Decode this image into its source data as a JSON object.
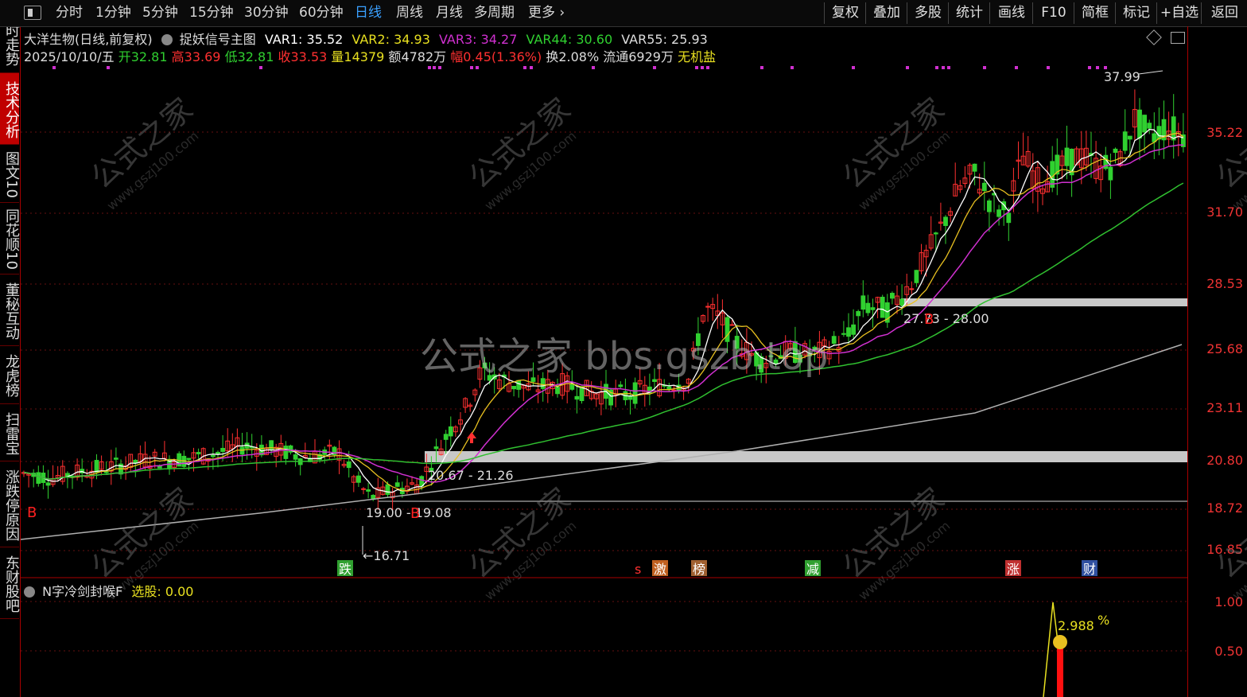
{
  "toolbar": {
    "left_items": [
      "分时",
      "1分钟",
      "5分钟",
      "15分钟",
      "30分钟",
      "60分钟",
      "日线",
      "周线",
      "月线",
      "多周期",
      "更多"
    ],
    "active": "日线",
    "right_items": [
      "复权",
      "叠加",
      "多股",
      "统计",
      "画线",
      "F10",
      "简框",
      "标记",
      "+自选",
      "返回"
    ]
  },
  "sidebar": [
    {
      "label": "分时走势",
      "active": false
    },
    {
      "label": "技术分析",
      "active": true
    },
    {
      "label": "图文10",
      "active": false
    },
    {
      "label": "同花顺10",
      "active": false
    },
    {
      "label": "董秘互动",
      "active": false
    },
    {
      "label": "龙虎榜",
      "active": false
    },
    {
      "label": "扫雷宝",
      "active": false
    },
    {
      "label": "涨跌停原因",
      "active": false
    },
    {
      "label": "东财股吧",
      "active": false
    }
  ],
  "header": {
    "stock": "大洋生物(日线,前复权)",
    "indicator": "捉妖信号主图",
    "var1": "VAR1: 35.52",
    "var2": "VAR2: 34.93",
    "var3": "VAR3: 34.27",
    "var44": "VAR44: 30.60",
    "var55": "VAR55: 25.93"
  },
  "quote": {
    "date": "2025/10/10/五",
    "open_label": "开",
    "open": "32.81",
    "high_label": "高",
    "high": "33.69",
    "low_label": "低",
    "low": "32.81",
    "close_label": "收",
    "close": "33.53",
    "vol_label": "量",
    "vol": "14379",
    "amt_label": "额",
    "amt": "4782万",
    "chg_label": "幅",
    "chg": "0.45(1.36%)",
    "turn": "换2.08%",
    "float": "流通6929万",
    "tag": "无机盐"
  },
  "axis_ticks": [
    "35.22",
    "31.70",
    "28.53",
    "25.68",
    "23.11",
    "20.80",
    "18.72",
    "16.85"
  ],
  "sub_axis_ticks": [
    "1.00",
    "0.50"
  ],
  "annotations": {
    "high": "37.99",
    "low": "16.71",
    "band1": "27.73 - 28.00",
    "band2": "20.67 - 21.26",
    "band3": "19.00 - 19.08"
  },
  "signals": [
    "跌",
    "s",
    "激",
    "榜",
    "减",
    "涨",
    "财"
  ],
  "buy_marker": "B",
  "subchart": {
    "title": "N字冷剑封喉F",
    "value": "选股: 0.00",
    "reading": "2.988",
    "unit": "%"
  },
  "watermark": {
    "brand": "公式之家",
    "url": "www.gszj100.com",
    "center": "公式之家 bbs.gszb.top"
  },
  "colors": {
    "up": "#ff3030",
    "down": "#30d030",
    "ma_white": "#ffffff",
    "ma_yellow": "#e8c020",
    "ma_magenta": "#d030d0",
    "ma_green": "#30c030",
    "ma_gray": "#b0b0b0",
    "band": "#c8c8c8"
  }
}
